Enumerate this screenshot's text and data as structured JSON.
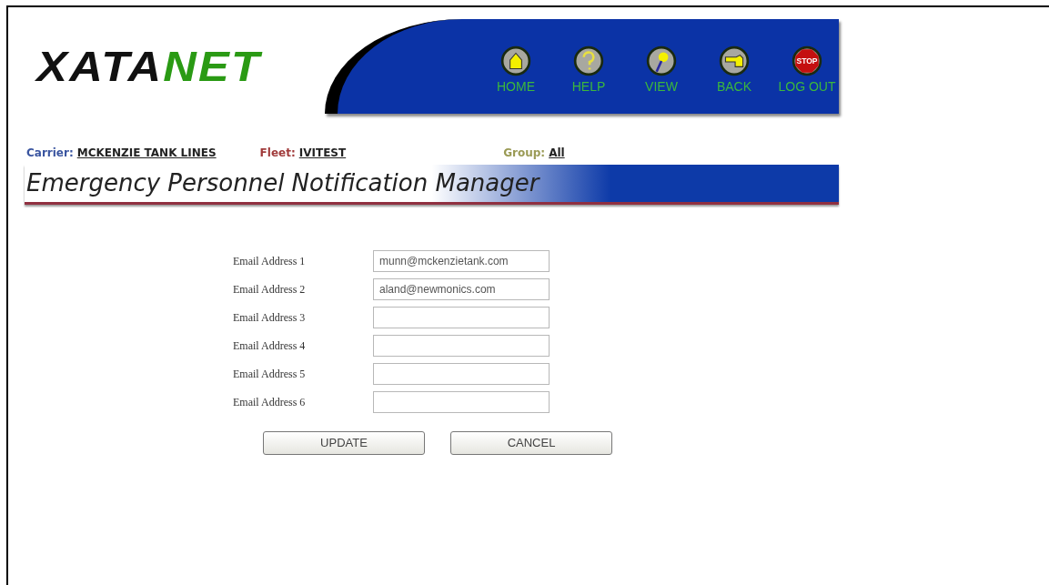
{
  "logo": {
    "dark": "XATA",
    "accent": "NET"
  },
  "nav": [
    {
      "kind": "home",
      "label": "HOME"
    },
    {
      "kind": "help",
      "label": "HELP"
    },
    {
      "kind": "view",
      "label": "VIEW"
    },
    {
      "kind": "back",
      "label": "BACK"
    },
    {
      "kind": "stop",
      "label": "LOG OUT",
      "icon_text": "STOP"
    }
  ],
  "context": [
    {
      "label": "Carrier:",
      "value": "MCKENZIE TANK LINES",
      "color": "#3a55a0"
    },
    {
      "label": "Fleet:",
      "value": "IVITEST",
      "color": "#a03a3a"
    },
    {
      "label": "Group:",
      "value": "All",
      "color": "#9a9a55"
    }
  ],
  "page_title": "Emergency Personnel Notification Manager",
  "fields": [
    {
      "label": "Email Address 1",
      "value": "munn@mckenzietank.com"
    },
    {
      "label": "Email Address 2",
      "value": "aland@newmonics.com"
    },
    {
      "label": "Email Address 3"
    },
    {
      "label": "Email Address 4"
    },
    {
      "label": "Email Address 5"
    },
    {
      "label": "Email Address 6"
    }
  ],
  "buttons": [
    "UPDATE",
    "CANCEL"
  ]
}
